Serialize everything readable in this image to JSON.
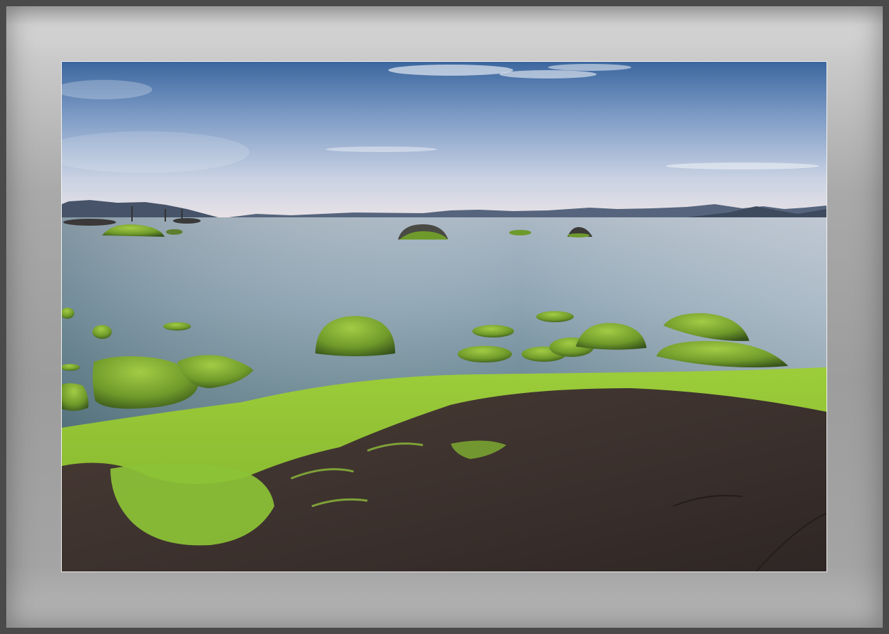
{
  "scene": {
    "subject": "mossy-rocks-lakeshore",
    "colors": {
      "frame_light": "#d6d6d6",
      "frame_dark": "#9d9d9d",
      "sky_top": "#3f6aa6",
      "sky_horizon": "#e6e3e8",
      "water": "#93a9b7",
      "moss": "#8fc23a",
      "rock": "#3e3430",
      "mountains": "#4a5a72"
    }
  }
}
